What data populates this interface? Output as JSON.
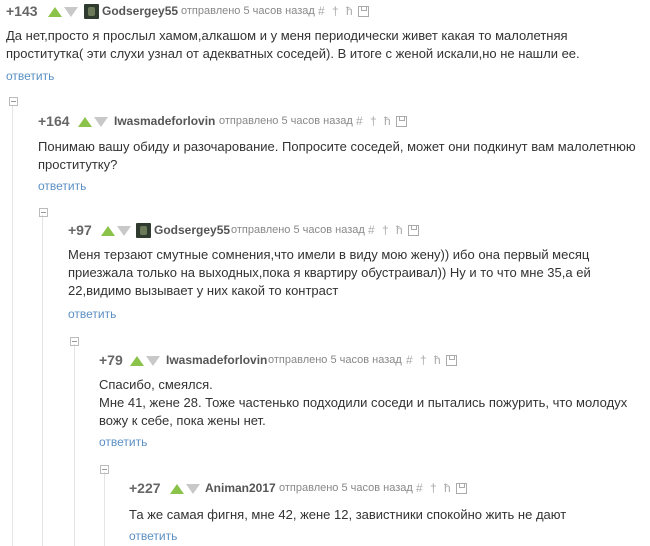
{
  "posted_label": "отправлено 5 часов назад",
  "reply_label": "ответить",
  "tools": {
    "hash": "#",
    "up": "†",
    "tree": "ħ"
  },
  "colors": {
    "up": "#8bc34a",
    "down": "#c8c8c8",
    "link": "#5a8fc3"
  },
  "comments": [
    {
      "rating": "+143",
      "user": "Godsergey55",
      "lines": [
        "Да нет,просто я прослыл хамом,алкашом и у меня периодически живет какая то малолетняя",
        "проститутка( эти слухи узнал от адекватных соседей). В итоге с женой искали,но не нашли ее."
      ]
    },
    {
      "rating": "+164",
      "user": "Iwasmadeforlovin",
      "lines": [
        "Понимаю вашу обиду и разочарование. Попросите соседей, может они подкинут вам малолетнюю",
        "проститутку?"
      ]
    },
    {
      "rating": "+97",
      "user": "Godsergey55",
      "lines": [
        "Меня терзают смутные сомнения,что имели в виду мою жену)) ибо она первый месяц",
        "приезжала только на выходных,пока я квартиру обустраивал)) Ну и то что мне 35,а ей",
        "22,видимо вызывает у них какой то контраст"
      ]
    },
    {
      "rating": "+79",
      "user": "Iwasmadeforlovin",
      "lines": [
        "Спасибо, смеялся.",
        "Мне 41, жене 28. Тоже частенько подходили соседи и пытались пожурить, что молодух",
        "вожу к себе, пока жены нет."
      ]
    },
    {
      "rating": "+227",
      "user": "Animan2017",
      "lines": [
        "Та же самая фигня, мне 42, жене 12, завистники спокойно жить не дают"
      ]
    }
  ]
}
